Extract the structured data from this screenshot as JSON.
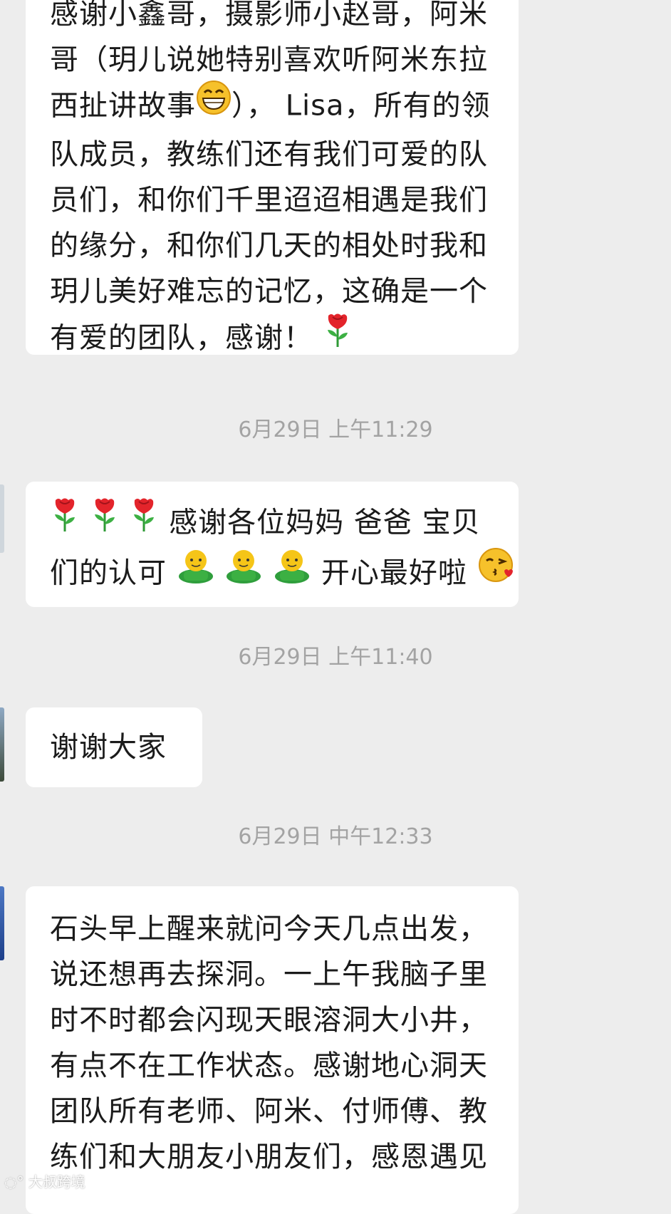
{
  "messages": [
    {
      "lines": [
        "感谢小鑫哥，摄影师小赵哥，阿米",
        "哥（玥儿说她特别喜欢听阿米东拉",
        "西扯讲故事",
        "）， Lisa，所有的领",
        "队成员，教练们还有我们可爱的队",
        "员们，和你们千里迢迢相遇是我们",
        "的缘分，和你们几天的相处时我和",
        "玥儿美好难忘的记忆，这确是一个",
        "有爱的团队，感谢！"
      ]
    },
    {
      "lines": [
        "感谢各位妈妈 爸爸 宝贝",
        "们的认可",
        "开心最好啦"
      ]
    },
    {
      "lines": [
        "谢谢大家"
      ]
    },
    {
      "lines": [
        "石头早上醒来就问今天几点出发，",
        "说还想再去探洞。一上午我脑子里",
        "时不时都会闪现天眼溶洞大小井，",
        "有点不在工作状态。感谢地心洞天",
        "团队所有老师、阿米、付师傅、教",
        "练们和大朋友小朋友们，感恩遇见"
      ]
    }
  ],
  "timestamps": [
    "6月29日 上午11:29",
    "6月29日 上午11:40",
    "6月29日 中午12:33"
  ],
  "icons": {
    "grin": "grinning-face-icon",
    "rose": "rose-icon",
    "person": "green-person-icon",
    "kiss": "kissing-face-icon"
  },
  "watermark": "大叔跨境",
  "colors": {
    "background": "#ededed",
    "bubble": "#ffffff",
    "text": "#1b1b1b",
    "timestamp": "#a3a3a3"
  }
}
